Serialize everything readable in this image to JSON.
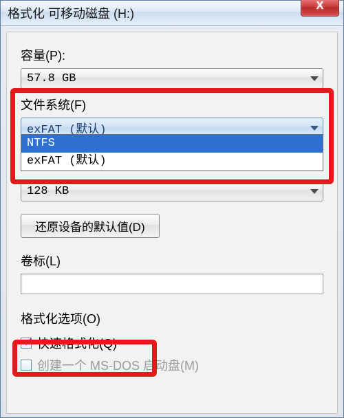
{
  "title": "格式化 可移动磁盘 (H:)",
  "close_glyph": "X",
  "capacity": {
    "label": "容量(P):",
    "value": "57.8 GB"
  },
  "filesystem": {
    "label": "文件系统(F)",
    "value": "exFAT (默认)",
    "options": [
      "NTFS",
      "exFAT (默认)"
    ],
    "selected_index": 0
  },
  "allocation": {
    "value": "128 KB"
  },
  "restore_btn": "还原设备的默认值(D)",
  "volume_label": {
    "label": "卷标(L)",
    "value": ""
  },
  "format_options_label": "格式化选项(O)",
  "quick_format": {
    "label": "快速格式化(Q)",
    "checked": true
  },
  "msdos": {
    "label": "创建一个 MS-DOS 启动盘(M)",
    "checked": false
  }
}
